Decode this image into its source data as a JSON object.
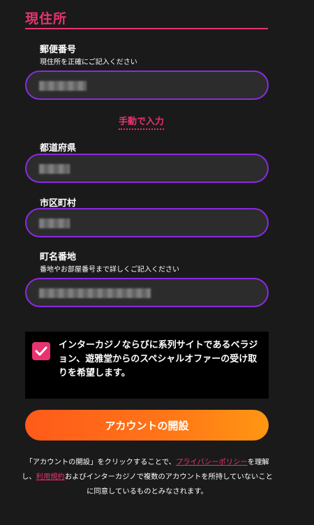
{
  "section": {
    "title": "現住所"
  },
  "fields": {
    "postal": {
      "label": "郵便番号",
      "hint": "現住所を正確にご記入ください"
    },
    "manual_entry": "手動で入力",
    "prefecture": {
      "label": "都道府県"
    },
    "city": {
      "label": "市区町村"
    },
    "street": {
      "label": "町名番地",
      "hint": "番地やお部屋番号まで詳しくご記入ください"
    }
  },
  "consent": {
    "checked": true,
    "text": "インターカジノならびに系列サイトであるベラジョン、遊雅堂からのスペシャルオファーの受け取りを希望します。"
  },
  "submit_label": "アカウントの開設",
  "notice": {
    "part1": "「アカウントの開設」をクリックすることで、",
    "privacy_link": "プライバシーポリシー",
    "part2": "を理解し、",
    "terms_link": "利用規約",
    "part3": "およびインターカジノで複数のアカウントを所持していないことに同意しているものとみなされます。"
  },
  "colors": {
    "accent": "#e8336f",
    "input_border": "#8a2be2",
    "button_start": "#ff5a1a",
    "button_end": "#ff9612",
    "background": "#1a1a1a"
  },
  "icons": {
    "checkbox": "checkmark-icon"
  }
}
